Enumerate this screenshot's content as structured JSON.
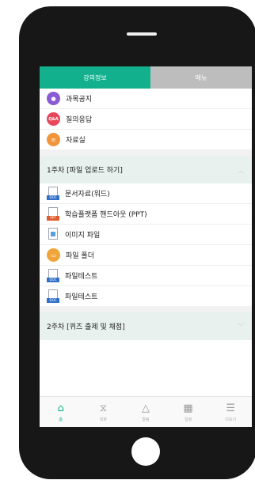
{
  "tabs": {
    "info": "강의정보",
    "menu": "메뉴"
  },
  "notice": {
    "label": "과목공지"
  },
  "qna": {
    "label": "질의응답",
    "badge": "Q&A"
  },
  "library": {
    "label": "자료실"
  },
  "week1": {
    "title": "1주차 [파일 업로드 하기]",
    "items": [
      {
        "label": "문서자료(워드)",
        "tag": "DOC"
      },
      {
        "label": "학습플랫폼 핸드아웃 (PPT)",
        "tag": "PPT"
      },
      {
        "label": "이미지 파일"
      },
      {
        "label": "파일 폴더"
      },
      {
        "label": "파일테스트",
        "tag": "DOC"
      },
      {
        "label": "파일테스트",
        "tag": "DOC"
      }
    ]
  },
  "week2": {
    "title": "2주차 [퀴즈 출제 및 채점]"
  },
  "bottom_nav": [
    {
      "label": "홈",
      "icon": "home-icon"
    },
    {
      "label": "대화",
      "icon": "chat-icon"
    },
    {
      "label": "알림",
      "icon": "bell-icon"
    },
    {
      "label": "일정",
      "icon": "calendar-icon"
    },
    {
      "label": "더보기",
      "icon": "menu-icon"
    }
  ],
  "colors": {
    "accent": "#12b08d",
    "section_bg": "#e8f1ee"
  }
}
